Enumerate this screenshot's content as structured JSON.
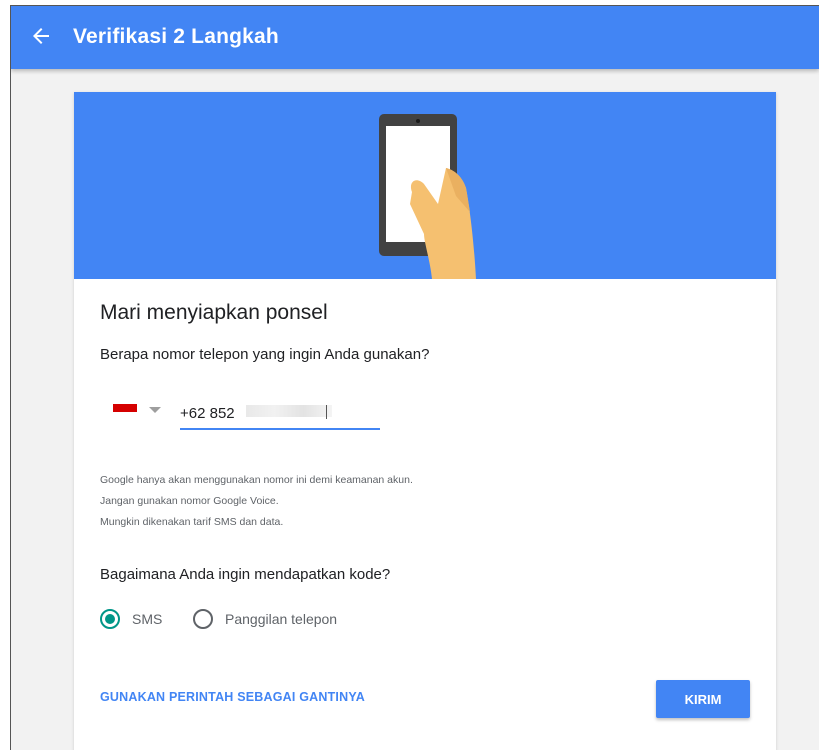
{
  "appbar": {
    "title": "Verifikasi 2 Langkah",
    "back_icon": "arrow-back-icon",
    "color": "#4285f4"
  },
  "setup": {
    "heading": "Mari menyiapkan ponsel",
    "phone_question": "Berapa nomor telepon yang ingin Anda gunakan?",
    "country_flag_icon": "indonesia-flag-icon",
    "phone_value": "+62 852",
    "notes": [
      "Google hanya akan menggunakan nomor ini demi keamanan akun.",
      "Jangan gunakan nomor Google Voice.",
      "Mungkin dikenakan tarif SMS dan data."
    ],
    "code_question": "Bagaimana Anda ingin mendapatkan kode?",
    "options": [
      {
        "label": "SMS",
        "selected": true
      },
      {
        "label": "Panggilan telepon",
        "selected": false
      }
    ],
    "alt_link": "GUNAKAN PERINTAH SEBAGAI GANTINYA",
    "send_label": "KIRIM"
  },
  "colors": {
    "accent": "#4285f4",
    "radio_selected": "#009688"
  }
}
